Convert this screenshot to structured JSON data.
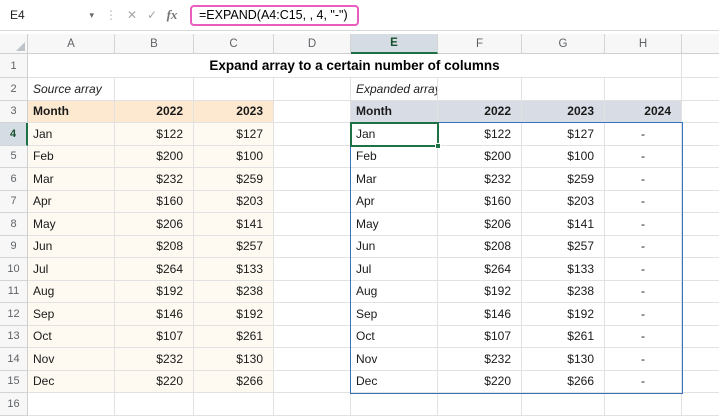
{
  "colors": {
    "selection_green": "#1e7145",
    "spill_blue": "#3573c0",
    "formula_annotation": "#e85dbe",
    "source_header_bg": "#fce9d0",
    "source_cell_bg": "#fefaf1",
    "expanded_header_bg": "#d7dce5",
    "header_sel_bg": "#d6dce3",
    "gridline": "#e2e2e2",
    "header_bg": "#f7f7f7",
    "header_text": "#5f6368"
  },
  "formula_bar": {
    "name_box": "E4",
    "formula": "=EXPAND(A4:C15, , 4, \"-\")",
    "icons": {
      "dropdown": "▾",
      "dots": "⋮",
      "cancel": "✕",
      "enter": "✓",
      "fx": "fx"
    }
  },
  "sheet": {
    "column_headers": [
      "A",
      "B",
      "C",
      "D",
      "E",
      "F",
      "G",
      "H"
    ],
    "row_headers": [
      "1",
      "2",
      "3",
      "4",
      "5",
      "6",
      "7",
      "8",
      "9",
      "10",
      "11",
      "12",
      "13",
      "14",
      "15",
      "16"
    ],
    "selected_column": "E",
    "selected_row": "4",
    "title": "Expand array to a certain number of columns",
    "source_table": {
      "label": "Source array",
      "headers": [
        "Month",
        "2022",
        "2023"
      ],
      "rows": [
        [
          "Jan",
          "$122",
          "$127"
        ],
        [
          "Feb",
          "$200",
          "$100"
        ],
        [
          "Mar",
          "$232",
          "$259"
        ],
        [
          "Apr",
          "$160",
          "$203"
        ],
        [
          "May",
          "$206",
          "$141"
        ],
        [
          "Jun",
          "$208",
          "$257"
        ],
        [
          "Jul",
          "$264",
          "$133"
        ],
        [
          "Aug",
          "$192",
          "$238"
        ],
        [
          "Sep",
          "$146",
          "$192"
        ],
        [
          "Oct",
          "$107",
          "$261"
        ],
        [
          "Nov",
          "$232",
          "$130"
        ],
        [
          "Dec",
          "$220",
          "$266"
        ]
      ]
    },
    "expanded_table": {
      "label": "Expanded array",
      "headers": [
        "Month",
        "2022",
        "2023",
        "2024"
      ],
      "rows": [
        [
          "Jan",
          "$122",
          "$127",
          "-"
        ],
        [
          "Feb",
          "$200",
          "$100",
          "-"
        ],
        [
          "Mar",
          "$232",
          "$259",
          "-"
        ],
        [
          "Apr",
          "$160",
          "$203",
          "-"
        ],
        [
          "May",
          "$206",
          "$141",
          "-"
        ],
        [
          "Jun",
          "$208",
          "$257",
          "-"
        ],
        [
          "Jul",
          "$264",
          "$133",
          "-"
        ],
        [
          "Aug",
          "$192",
          "$238",
          "-"
        ],
        [
          "Sep",
          "$146",
          "$192",
          "-"
        ],
        [
          "Oct",
          "$107",
          "$261",
          "-"
        ],
        [
          "Nov",
          "$232",
          "$130",
          "-"
        ],
        [
          "Dec",
          "$220",
          "$266",
          "-"
        ]
      ]
    }
  }
}
